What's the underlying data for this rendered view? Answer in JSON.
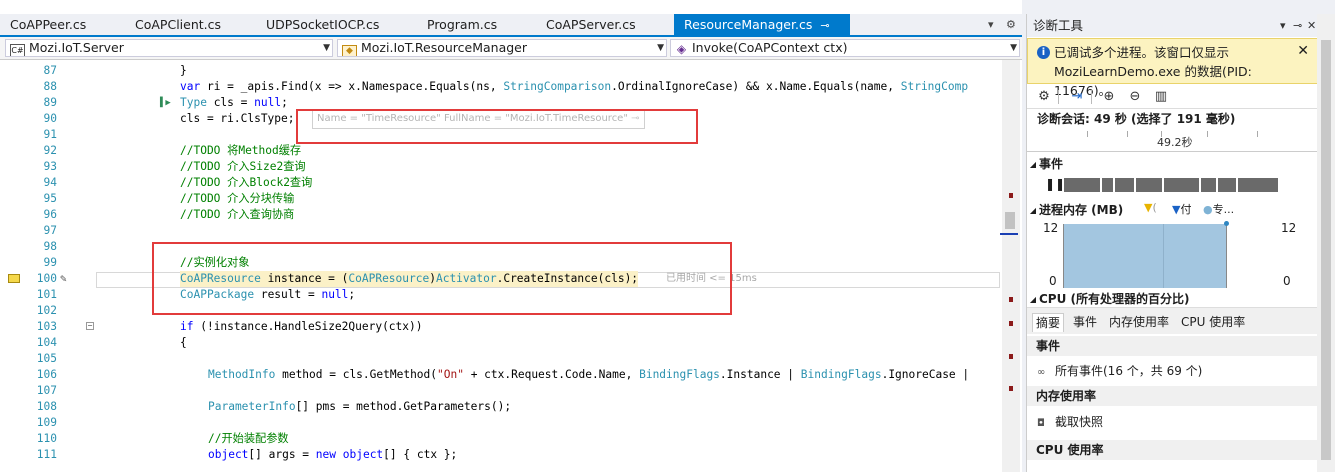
{
  "tabs": [
    {
      "label": "CoAPPeer.cs"
    },
    {
      "label": "CoAPClient.cs"
    },
    {
      "label": "UDPSocketIOCP.cs"
    },
    {
      "label": "Program.cs"
    },
    {
      "label": "CoAPServer.cs"
    },
    {
      "label": "ResourceManager.cs",
      "active": true
    }
  ],
  "tab_controls": {
    "dropdown": "▾",
    "settings": "⚙"
  },
  "nav": {
    "project": "Mozi.IoT.Server",
    "class": "Mozi.IoT.ResourceManager",
    "member": "Invoke(CoAPContext ctx)"
  },
  "code_lines": [
    {
      "num": "87",
      "text": "}"
    },
    {
      "num": "88",
      "text": "var ri = _apis.Find(x => x.Namespace.Equals(ns, StringComparison.OrdinalIgnoreCase) && x.Name.Equals(name, StringComp"
    },
    {
      "num": "89",
      "text": "Type cls = null;"
    },
    {
      "num": "90",
      "text": "cls = ri.ClsType;"
    },
    {
      "num": "91",
      "text": ""
    },
    {
      "num": "92",
      "text": "//TODO 将Method缓存"
    },
    {
      "num": "93",
      "text": "//TODO 介入Size2查询"
    },
    {
      "num": "94",
      "text": "//TODO 介入Block2查询"
    },
    {
      "num": "95",
      "text": "//TODO 介入分块传输"
    },
    {
      "num": "96",
      "text": "//TODO 介入查询协商"
    },
    {
      "num": "97",
      "text": ""
    },
    {
      "num": "98",
      "text": ""
    },
    {
      "num": "99",
      "text": "//实例化对象"
    },
    {
      "num": "100",
      "text": "CoAPResource instance = (CoAPResource)Activator.CreateInstance(cls);"
    },
    {
      "num": "101",
      "text": "CoAPPackage result = null;"
    },
    {
      "num": "102",
      "text": ""
    },
    {
      "num": "103",
      "text": "if (!instance.HandleSize2Query(ctx))"
    },
    {
      "num": "104",
      "text": "{"
    },
    {
      "num": "105",
      "text": ""
    },
    {
      "num": "106",
      "text": "MethodInfo method = cls.GetMethod(\"On\" + ctx.Request.Code.Name, BindingFlags.Instance | BindingFlags.IgnoreCase |"
    },
    {
      "num": "107",
      "text": ""
    },
    {
      "num": "108",
      "text": "ParameterInfo[] pms = method.GetParameters();"
    },
    {
      "num": "109",
      "text": ""
    },
    {
      "num": "110",
      "text": "//开始装配参数"
    },
    {
      "num": "111",
      "text": "object[] args = new object[] { ctx };"
    }
  ],
  "datatip": "Name = \"TimeResource\" FullName = \"Mozi.IoT.TimeResource\"",
  "elapsed_hint": "已用时间 <= 15ms",
  "diag": {
    "title": "诊断工具",
    "info_line1": "已调试多个进程。该窗口仅显示",
    "info_line2": "MoziLearnDemo.exe 的数据(PID: 11676)。",
    "session": "诊断会话: 49 秒 (选择了 191 毫秒)",
    "ruler_label": "49.2秒",
    "events_header": "事件",
    "memory_header": "进程内存 (MB)",
    "legend_gc": "(",
    "legend_snapshot": "付",
    "legend_private": "专...",
    "mem_max": "12",
    "mem_min": "0",
    "cpu_header": "CPU (所有处理器的百分比)",
    "subtabs": [
      "摘要",
      "事件",
      "内存使用率",
      "CPU 使用率"
    ],
    "summary_events": "事件",
    "all_events": "所有事件(16 个，共 69 个)",
    "summary_memory": "内存使用率",
    "snapshot": "截取快照",
    "summary_cpu": "CPU 使用率"
  },
  "colors": {
    "accent": "#007acc",
    "highlight": "#fbf1c7",
    "annotation": "#e23b3b",
    "chart_fill": "#a3c6e0"
  }
}
